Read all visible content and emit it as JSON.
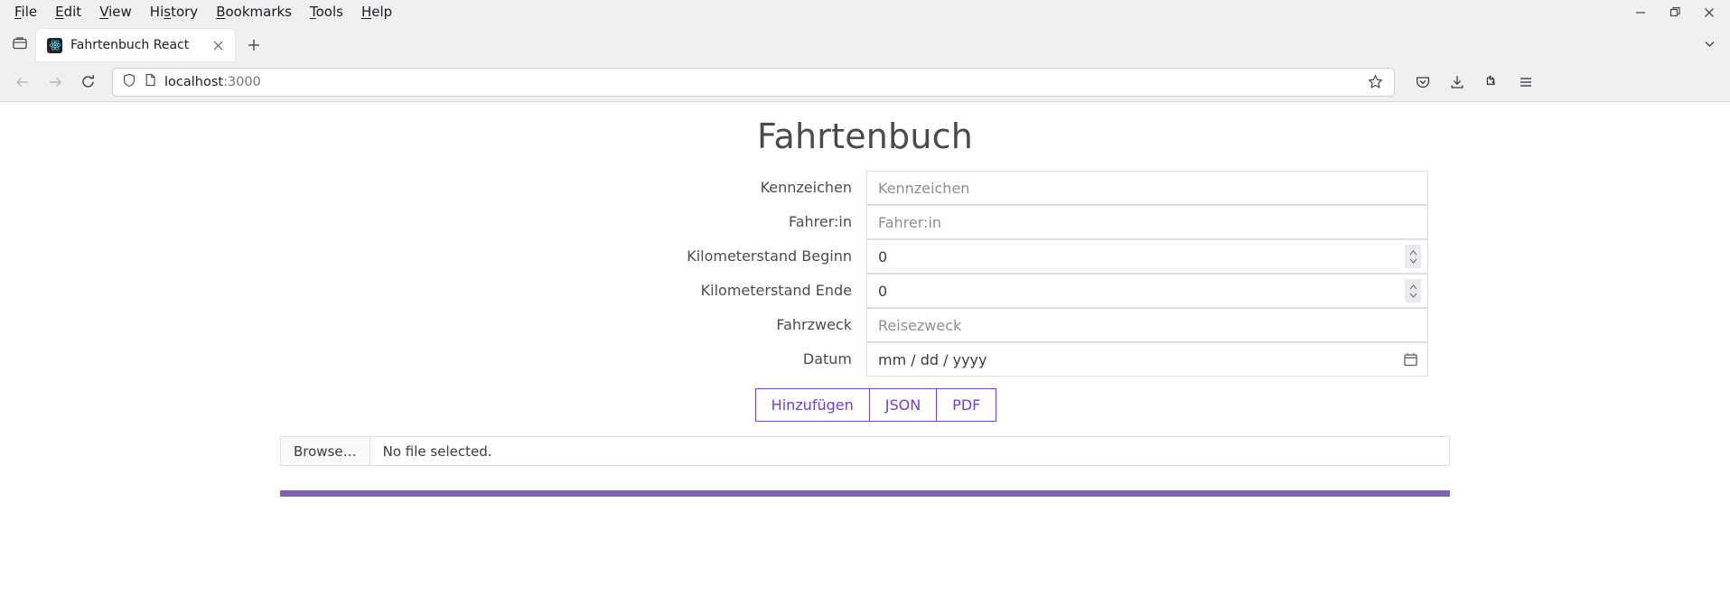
{
  "browser": {
    "menus": [
      {
        "label": "File",
        "mnemonic": "F"
      },
      {
        "label": "Edit",
        "mnemonic": "E"
      },
      {
        "label": "View",
        "mnemonic": "V"
      },
      {
        "label": "History",
        "mnemonic": "s"
      },
      {
        "label": "Bookmarks",
        "mnemonic": "B"
      },
      {
        "label": "Tools",
        "mnemonic": "T"
      },
      {
        "label": "Help",
        "mnemonic": "H"
      }
    ],
    "window_controls": {
      "minimize": "minimize-icon",
      "maximize": "maximize-icon",
      "close": "close-icon"
    },
    "tab": {
      "title": "Fahrtenbuch React",
      "favicon": "react-logo-icon",
      "close": "close-icon"
    },
    "new_tab_label": "+",
    "list_all_tabs": "chevron-down-icon",
    "nav": {
      "back": "back-arrow-icon",
      "forward": "forward-arrow-icon",
      "reload": "reload-icon"
    },
    "url": {
      "host": "localhost",
      "port": ":3000",
      "shield": "shield-icon",
      "page_icon": "page-icon",
      "bookmark": "star-icon"
    },
    "toolbar_right": [
      "pocket-icon",
      "download-icon",
      "extensions-icon",
      "app-menu-icon"
    ]
  },
  "app": {
    "title": "Fahrtenbuch",
    "fields": [
      {
        "label": "Kennzeichen",
        "value": "",
        "placeholder": "Kennzeichen",
        "type": "text"
      },
      {
        "label": "Fahrer:in",
        "value": "",
        "placeholder": "Fahrer:in",
        "type": "text"
      },
      {
        "label": "Kilometerstand Beginn",
        "value": "0",
        "placeholder": "",
        "type": "number"
      },
      {
        "label": "Kilometerstand Ende",
        "value": "0",
        "placeholder": "",
        "type": "number"
      },
      {
        "label": "Fahrzweck",
        "value": "",
        "placeholder": "Reisezweck",
        "type": "text"
      },
      {
        "label": "Datum",
        "value": "mm / dd / yyyy",
        "placeholder": "mm / dd / yyyy",
        "type": "date"
      }
    ],
    "buttons": [
      {
        "label": "Hinzufügen"
      },
      {
        "label": "JSON"
      },
      {
        "label": "PDF"
      }
    ],
    "file_input": {
      "browse_label": "Browse…",
      "status": "No file selected."
    },
    "accent_color": "#6f42c1",
    "bar_color": "#7e63b0"
  }
}
